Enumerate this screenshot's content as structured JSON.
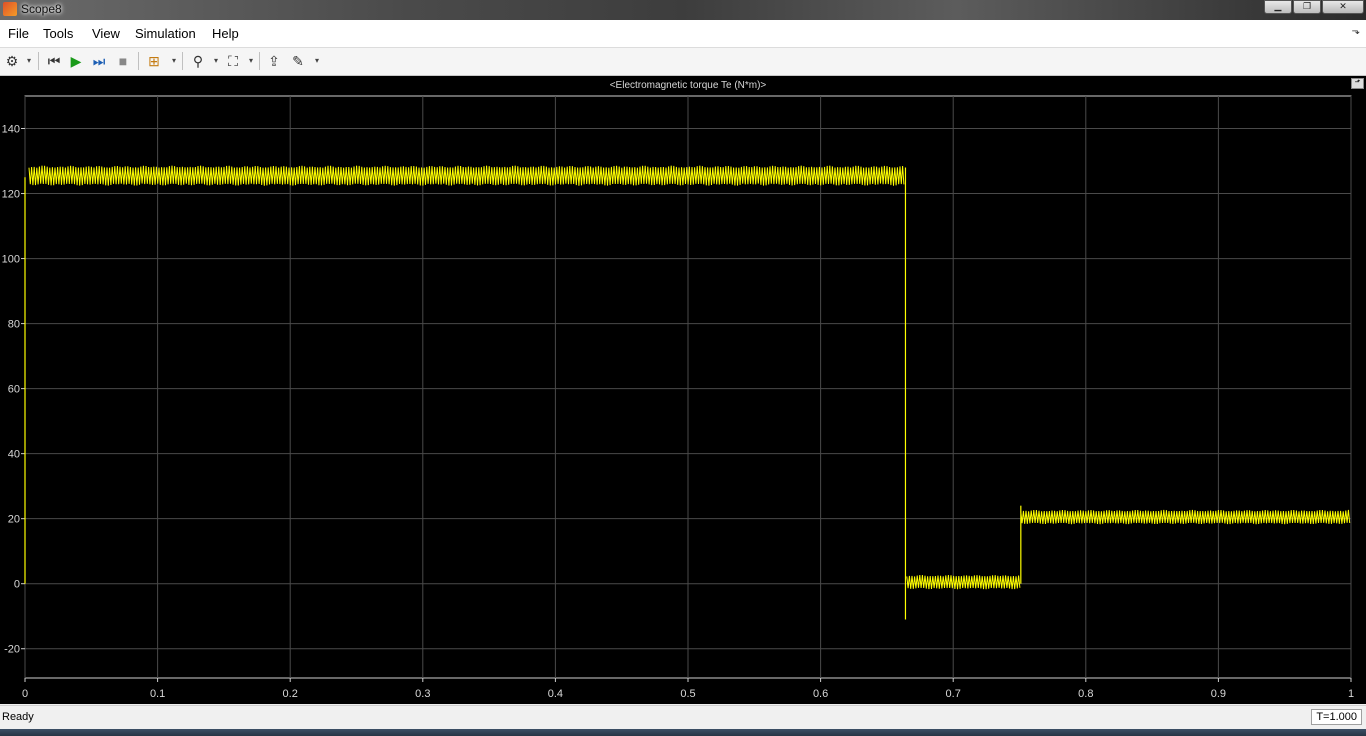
{
  "window": {
    "title": "Scope8"
  },
  "window_buttons": [
    "▁",
    "❐",
    "✕"
  ],
  "menu": {
    "items": [
      "File",
      "Tools",
      "View",
      "Simulation",
      "Help"
    ]
  },
  "toolbar": {
    "icons": [
      "gear-icon",
      "step-back-icon",
      "run-icon",
      "step-forward-icon",
      "stop-icon",
      "signal-selector-icon",
      "zoom-icon",
      "fit-axes-icon",
      "highlight-block-icon",
      "style-icon"
    ]
  },
  "chart_data": {
    "type": "line",
    "title": "<Electromagnetic torque Te (N*m)>",
    "xlabel": "",
    "ylabel": "",
    "xlim": [
      0,
      1
    ],
    "ylim": [
      -29,
      150
    ],
    "xticks": [
      0,
      0.1,
      0.2,
      0.3,
      0.4,
      0.5,
      0.6,
      0.7,
      0.8,
      0.9,
      1
    ],
    "xtick_labels": [
      "0",
      "0.1",
      "0.2",
      "0.3",
      "0.4",
      "0.5",
      "0.6",
      "0.7",
      "0.8",
      "0.9",
      "1"
    ],
    "yticks": [
      -20,
      0,
      20,
      40,
      60,
      80,
      100,
      120,
      140
    ],
    "ytick_labels": [
      "-20",
      "0",
      "20",
      "40",
      "60",
      "80",
      "100",
      "120",
      "140"
    ],
    "grid": true,
    "background": "#000000",
    "grid_color": "#4a4a4a",
    "series": [
      {
        "color": "#ffff00",
        "segments": [
          {
            "x_start": 0.003,
            "x_end": 0.663,
            "y_low": 122,
            "y_high": 129
          },
          {
            "x_start": 0.665,
            "x_end": 0.751,
            "y_low": -2,
            "y_high": 3
          },
          {
            "x_start": 0.751,
            "x_end": 1.0,
            "y_low": 18,
            "y_high": 23
          }
        ],
        "transitions": [
          {
            "x": 0.0,
            "y_from": 0,
            "y_to": 125
          },
          {
            "x": 0.664,
            "y_from": 128,
            "y_to": -11
          },
          {
            "x": 0.751,
            "y_from": 0,
            "y_to": 24
          }
        ]
      }
    ]
  },
  "status": {
    "ready": "Ready",
    "time": "T=1.000"
  },
  "undock_label": "⬎",
  "scope_corner_label": "⬏"
}
